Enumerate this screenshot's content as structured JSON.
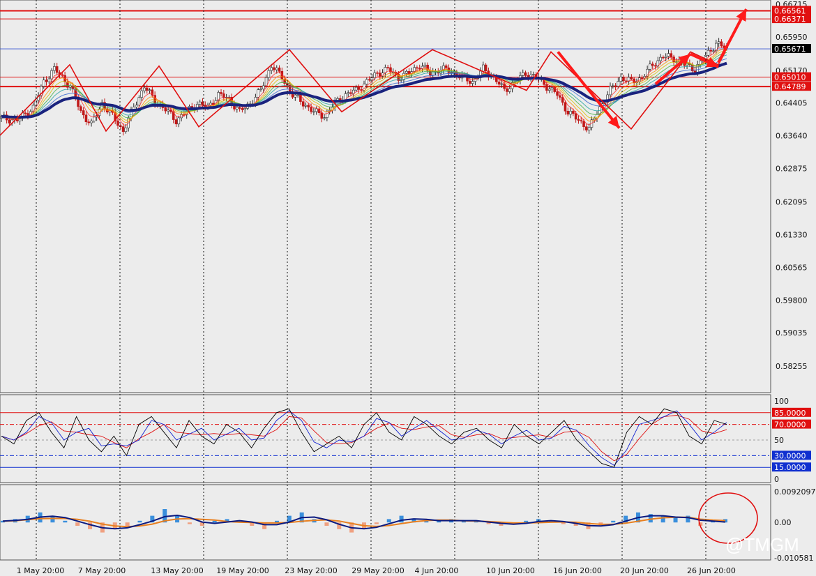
{
  "chart_data": {
    "type": "candlestick",
    "instrument_note": "",
    "x_tick_labels": [
      "1 May 20:00",
      "7 May 20:00",
      "13 May 20:00",
      "19 May 20:00",
      "23 May 20:00",
      "29 May 20:00",
      "4 Jun 20:00",
      "10 Jun 20:00",
      "16 Jun 20:00",
      "20 Jun 20:00",
      "26 Jun 20:00"
    ],
    "price_panel": {
      "ylim": [
        0.578,
        0.66715
      ],
      "tick_labels": [
        "0.66715",
        "0.65950",
        "0.65170",
        "0.64405",
        "0.63640",
        "0.62875",
        "0.62095",
        "0.61330",
        "0.60565",
        "0.59800",
        "0.59035",
        "0.58255"
      ],
      "current_price": "0.65671",
      "levels": [
        {
          "label": "0.66561",
          "value": 0.66561,
          "color": "#e01010",
          "kind": "resistance"
        },
        {
          "label": "0.66371",
          "value": 0.66371,
          "color": "#e01010",
          "kind": "resistance"
        },
        {
          "label": "0.65010",
          "value": 0.6501,
          "color": "#e01010",
          "kind": "support"
        },
        {
          "label": "0.64789",
          "value": 0.64789,
          "color": "#e01010",
          "kind": "support"
        }
      ],
      "close_path": [
        [
          0,
          0.6405
        ],
        [
          6,
          0.64
        ],
        [
          12,
          0.643
        ],
        [
          16,
          0.649
        ],
        [
          20,
          0.652
        ],
        [
          26,
          0.648
        ],
        [
          30,
          0.642
        ],
        [
          34,
          0.639
        ],
        [
          38,
          0.644
        ],
        [
          42,
          0.641
        ],
        [
          46,
          0.6375
        ],
        [
          50,
          0.643
        ],
        [
          54,
          0.648
        ],
        [
          58,
          0.6445
        ],
        [
          62,
          0.6425
        ],
        [
          66,
          0.64
        ],
        [
          70,
          0.642
        ],
        [
          74,
          0.644
        ],
        [
          78,
          0.643
        ],
        [
          82,
          0.646
        ],
        [
          86,
          0.645
        ],
        [
          90,
          0.642
        ],
        [
          94,
          0.644
        ],
        [
          98,
          0.647
        ],
        [
          102,
          0.653
        ],
        [
          106,
          0.65
        ],
        [
          110,
          0.646
        ],
        [
          114,
          0.644
        ],
        [
          118,
          0.642
        ],
        [
          122,
          0.641
        ],
        [
          126,
          0.644
        ],
        [
          130,
          0.646
        ],
        [
          134,
          0.647
        ],
        [
          138,
          0.649
        ],
        [
          142,
          0.651
        ],
        [
          146,
          0.652
        ],
        [
          150,
          0.65
        ],
        [
          154,
          0.651
        ],
        [
          158,
          0.653
        ],
        [
          162,
          0.651
        ],
        [
          166,
          0.652
        ],
        [
          170,
          0.6515
        ],
        [
          174,
          0.65
        ],
        [
          178,
          0.649
        ],
        [
          182,
          0.652
        ],
        [
          186,
          0.65
        ],
        [
          190,
          0.647
        ],
        [
          194,
          0.649
        ],
        [
          198,
          0.651
        ],
        [
          202,
          0.65
        ],
        [
          206,
          0.648
        ],
        [
          210,
          0.646
        ],
        [
          214,
          0.642
        ],
        [
          218,
          0.64
        ],
        [
          222,
          0.638
        ],
        [
          226,
          0.643
        ],
        [
          230,
          0.647
        ],
        [
          234,
          0.65
        ],
        [
          238,
          0.649
        ],
        [
          242,
          0.65
        ],
        [
          246,
          0.653
        ],
        [
          250,
          0.655
        ],
        [
          254,
          0.6545
        ],
        [
          258,
          0.653
        ],
        [
          262,
          0.652
        ],
        [
          266,
          0.655
        ],
        [
          270,
          0.658
        ],
        [
          274,
          0.6567
        ]
      ]
    },
    "stoch_panel": {
      "ylim": [
        0,
        100
      ],
      "tick_labels": [
        "100",
        "50",
        "0"
      ],
      "levels": [
        {
          "label": "85.0000",
          "value": 85,
          "color": "#e01010"
        },
        {
          "label": "70.0000",
          "value": 70,
          "color": "#e01010"
        },
        {
          "label": "30.0000",
          "value": 30,
          "color": "#1030d0"
        },
        {
          "label": "15.0000",
          "value": 15,
          "color": "#1030d0"
        }
      ],
      "series": [
        {
          "color": "#000000",
          "values": [
            55,
            45,
            75,
            85,
            60,
            40,
            80,
            50,
            35,
            55,
            30,
            70,
            80,
            60,
            40,
            75,
            55,
            45,
            70,
            60,
            40,
            65,
            85,
            90,
            60,
            35,
            45,
            55,
            40,
            70,
            85,
            60,
            50,
            80,
            70,
            55,
            45,
            60,
            65,
            50,
            40,
            70,
            55,
            45,
            60,
            75,
            50,
            35,
            20,
            15,
            60,
            80,
            70,
            90,
            85,
            55,
            45,
            75,
            70
          ]
        }
      ]
    },
    "macd_panel": {
      "ylim": [
        -0.010581,
        0.0092097
      ],
      "tick_labels": [
        "0.0092097",
        "0.00",
        "-0.010581"
      ],
      "histogram": [
        0.0005,
        0.001,
        0.002,
        0.003,
        0.002,
        0.0005,
        -0.001,
        -0.002,
        -0.003,
        -0.002,
        -0.001,
        0.0005,
        0.002,
        0.004,
        0.002,
        -0.0005,
        -0.001,
        0.0005,
        0.001,
        0.0005,
        -0.001,
        -0.002,
        0.0005,
        0.002,
        0.003,
        0.001,
        -0.001,
        -0.002,
        -0.003,
        -0.002,
        -0.0005,
        0.001,
        0.002,
        0.001,
        0.0005,
        0.0005,
        0.001,
        0.0005,
        0.0005,
        -0.0005,
        -0.001,
        -0.0005,
        0.0005,
        0.001,
        0.0005,
        -0.0005,
        -0.001,
        -0.002,
        -0.001,
        0.0005,
        0.002,
        0.003,
        0.0025,
        0.002,
        0.0015,
        0.002,
        -0.001,
        0.0005,
        0.001
      ],
      "signal_color": "#e88020",
      "macd_color": "#0a1a80"
    }
  },
  "watermark": "@TMGM"
}
